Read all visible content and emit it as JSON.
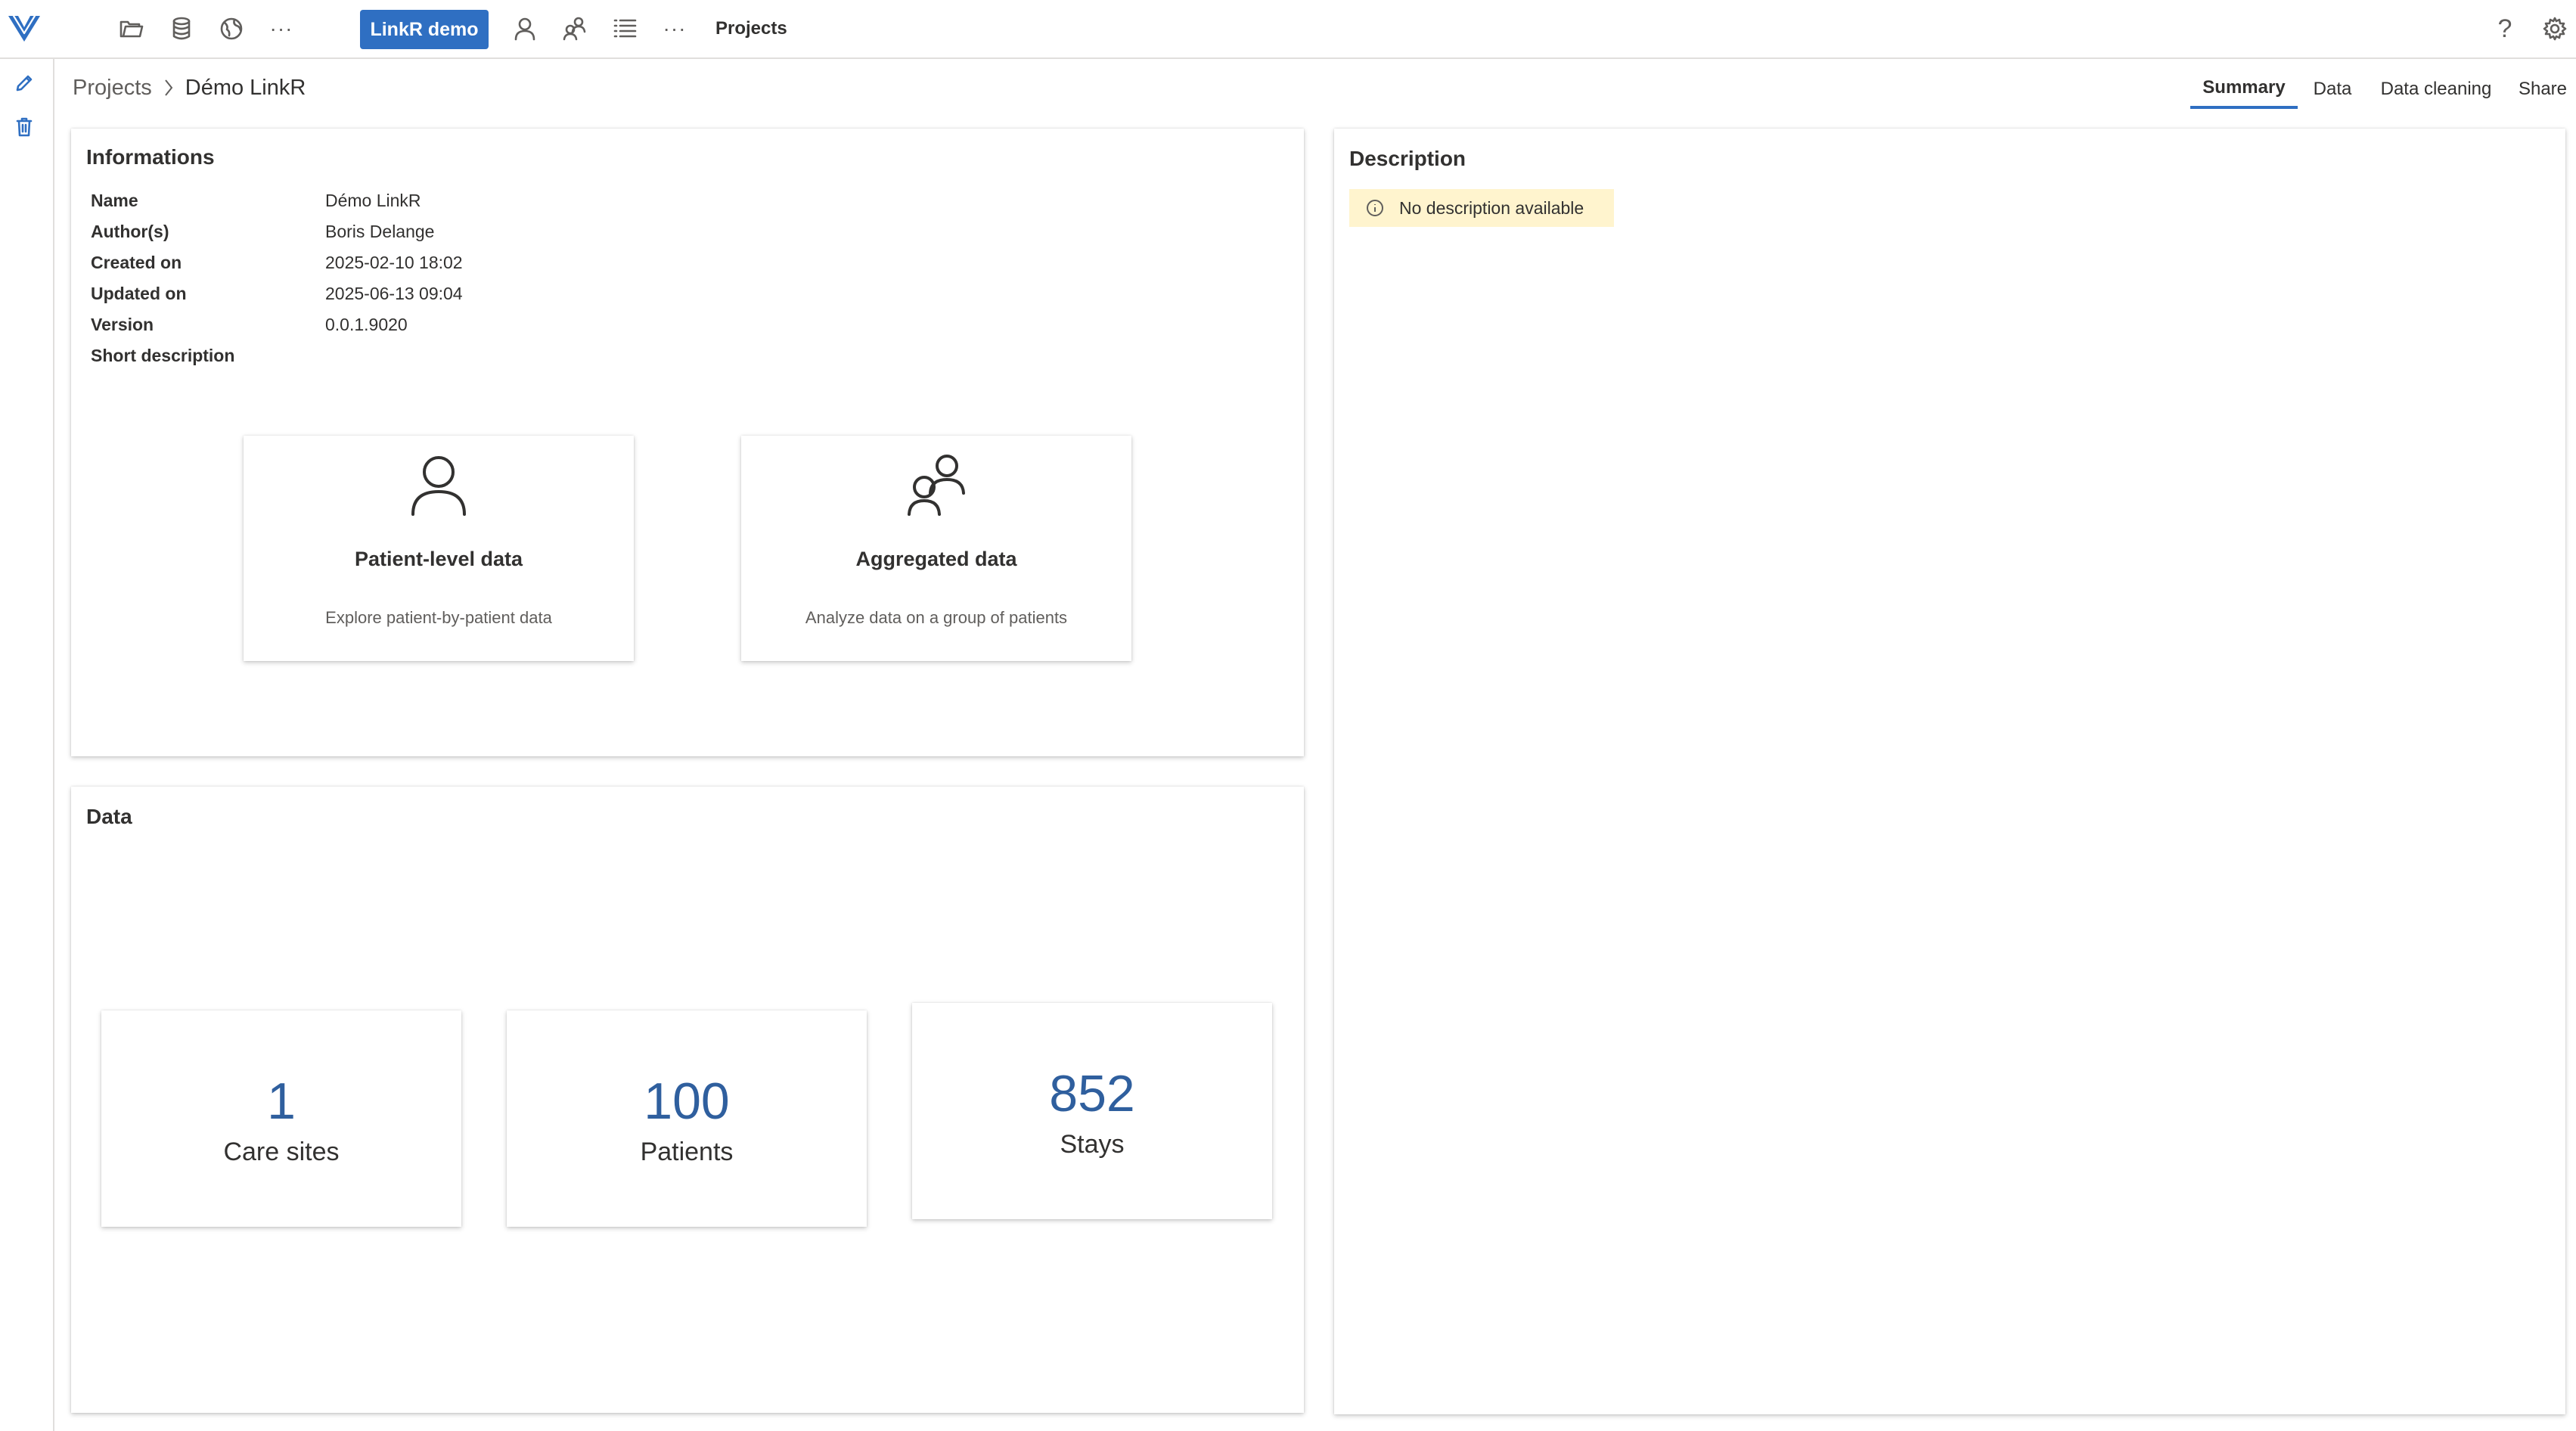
{
  "topbar": {
    "icons": [
      "logo-icon",
      "folder-icon",
      "database-icon",
      "globe-icon",
      "more-icon",
      "person-icon",
      "people-icon",
      "list-icon",
      "more-icon",
      "help-icon",
      "gear-icon"
    ],
    "project_chip": "LinkR demo",
    "more_1": "···",
    "more_2": "···",
    "section_title": "Projects",
    "help": "?"
  },
  "rail": {
    "icons": [
      "edit-icon",
      "delete-icon"
    ]
  },
  "breadcrumb": {
    "parent": "Projects",
    "current": "Démo LinkR"
  },
  "tabs": [
    {
      "label": "Summary",
      "active": true
    },
    {
      "label": "Data",
      "active": false
    },
    {
      "label": "Data cleaning",
      "active": false
    },
    {
      "label": "Share",
      "active": false
    }
  ],
  "informations": {
    "title": "Informations",
    "rows": [
      {
        "key": "Name",
        "value": "Démo LinkR"
      },
      {
        "key": "Author(s)",
        "value": "Boris Delange"
      },
      {
        "key": "Created on",
        "value": "2025-02-10 18:02"
      },
      {
        "key": "Updated on",
        "value": "2025-06-13 09:04"
      },
      {
        "key": "Version",
        "value": "0.0.1.9020"
      },
      {
        "key": "Short description",
        "value": ""
      }
    ],
    "tiles": [
      {
        "title": "Patient-level data",
        "subtitle": "Explore patient-by-patient data",
        "icon": "person-icon"
      },
      {
        "title": "Aggregated data",
        "subtitle": "Analyze data on a group of patients",
        "icon": "people-icon"
      }
    ]
  },
  "data_section": {
    "title": "Data",
    "stats": [
      {
        "value": "1",
        "label": "Care sites"
      },
      {
        "value": "100",
        "label": "Patients"
      },
      {
        "value": "852",
        "label": "Stays"
      }
    ]
  },
  "description": {
    "title": "Description",
    "message": "No description available",
    "message_icon": "info-icon"
  },
  "colors": {
    "accent": "#2f6fc2",
    "stat_number": "#2f5f9e",
    "warning_bg": "#fff4ce"
  }
}
